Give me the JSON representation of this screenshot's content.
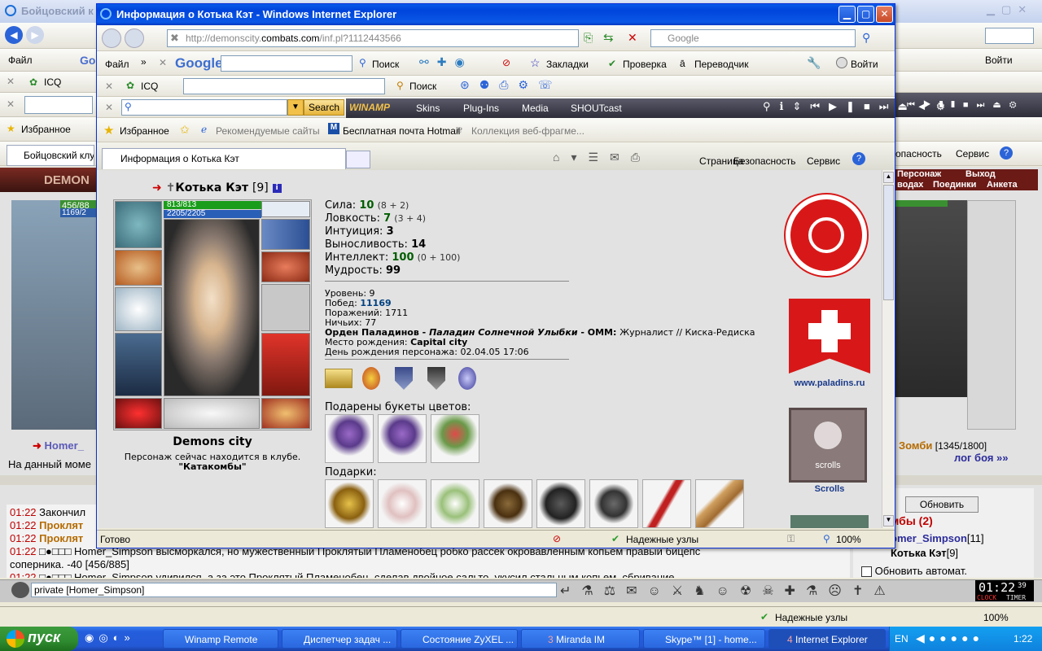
{
  "background_window": {
    "title": "Бойцовский к",
    "menu_file": "Файл",
    "google_fragment": "Go",
    "icq": "ICQ",
    "favorites": "Избранное",
    "tab_title": "Бойцовский клуб",
    "security_fragment": "опасность",
    "service": "Сервис",
    "tab_personazh": "Персонаж",
    "tab_vyhod": "Выход",
    "tab_vodah": "водах",
    "tab_poedinki": "Поединки",
    "tab_anketa": "Анкета",
    "left_hp": "456/88",
    "left_mp": "1169/2",
    "left_player_link": "Homer_",
    "left_note": "На данный моме",
    "right_player": "Зомби",
    "right_hp": "[1345/1800]",
    "log_link": "лог боя »»",
    "refresh_button": "Обновить",
    "zombies_count": "мбы (2)",
    "list_user1": "omer_Simpson",
    "list_user1_level": "[11]",
    "list_user2": "Котька Кэт",
    "list_user2_level": "[9]",
    "auto_refresh": "Обновить автомат.",
    "chat_lines": [
      {
        "time": "01:22",
        "text": "Закончил"
      },
      {
        "time": "01:22",
        "text": "Проклят"
      },
      {
        "time": "01:22",
        "text": "Проклят"
      },
      {
        "time": "01:22",
        "text": "□●□□□ Homer_Simpson высморкался, но мужественный Проклятый Пламенобец робко рассек окровавленным копьем правый бицепс"
      },
      {
        "time": "",
        "text": "соперника. -40 [456/885]"
      },
      {
        "time": "01:22",
        "text": "□●□□□ Homer_Simpson удивился, а за это Проклятый Пламенобец, сделав двойное сальто, укусил стальным копьем, сбривание"
      }
    ],
    "chat_input": "private [Homer_Simpson]",
    "clock": "01:22",
    "clock_seconds": "39",
    "clock_label": "CLOCK",
    "timer_label": "TIMER",
    "status_zone": "Надежные узлы",
    "status_zoom": "100%"
  },
  "taskbar": {
    "start": "пуск",
    "tasks": [
      "Winamp Remote",
      "Диспетчер задач ...",
      "Состояние ZyXEL ...",
      "Miranda IM",
      "Skype™ [1] - home...",
      "Internet Explorer"
    ],
    "miranda_count": "3",
    "ie_count": "4",
    "lang": "EN",
    "time": "1:22"
  },
  "ie": {
    "title": "Информация о Котька Кэт - Windows Internet Explorer",
    "address_prefix": "http://demonscity.",
    "address_domain": "combats.com",
    "address_suffix": "/inf.pl?1112443566",
    "search_placeholder": "Google",
    "menu_file": "Файл",
    "google_label": "Google",
    "poisk": "Поиск",
    "zakladki": "Закладки",
    "proverka": "Проверка",
    "perevodchik": "Переводчик",
    "voiti": "Войти",
    "icq": "ICQ",
    "icq_poisk": "Поиск",
    "search_button": "Search",
    "winamp_logo": "WINAMP",
    "skins": "Skins",
    "plugins": "Plug-Ins",
    "media": "Media",
    "shoutcast": "SHOUTcast",
    "favorites": "Избранное",
    "fav1": "Рекомендуемые сайты",
    "fav2": "Бесплатная почта Hotmail",
    "fav3": "Коллекция веб-фрагме...",
    "tab_title": "Информация о Котька Кэт",
    "cmd_page": "Страница",
    "cmd_security": "Безопасность",
    "cmd_service": "Сервис",
    "status_ready": "Готово",
    "status_zone": "Надежные узлы",
    "status_zoom": "100%"
  },
  "character": {
    "name": "Котька Кэт",
    "level_tag": "[9]",
    "hp": "813/813",
    "mp": "2205/2205",
    "hp_fraction": 1.0,
    "mp_fraction": 1.0,
    "city": "Demons city",
    "location_text": "Персонаж сейчас находится в клубе.",
    "location_room": "\"Катакомбы\"",
    "stats": [
      {
        "label": "Сила:",
        "value": "10",
        "mod": "(8 + 2)"
      },
      {
        "label": "Ловкость:",
        "value": "7",
        "mod": "(3 + 4)"
      },
      {
        "label": "Интуиция:",
        "value": "3",
        "mod": ""
      },
      {
        "label": "Выносливость:",
        "value": "14",
        "mod": ""
      },
      {
        "label": "Интеллект:",
        "value": "100",
        "mod": "(0 + 100)"
      },
      {
        "label": "Мудрость:",
        "value": "99",
        "mod": ""
      }
    ],
    "level_label": "Уровень:",
    "level": "9",
    "wins_label": "Побед:",
    "wins": "11169",
    "losses_label": "Поражений:",
    "losses": "1711",
    "draws_label": "Ничьих:",
    "draws": "77",
    "order": "Орден Паладинов",
    "order_sep": " - ",
    "order_rank": "Паладин Солнечной Улыбки",
    "omm_label": " - ОММ: ",
    "omm_value": "Журналист // Киска-Редиска",
    "birthplace_label": "Место рождения:",
    "birthplace": "Capital city",
    "birthday_label": "День рождения персонажа:",
    "birthday": "02.04.05 17:06",
    "flowers_label": "Подарены букеты цветов:",
    "gifts_label": "Подарки:",
    "paladins_url": "www.paladins.ru",
    "scrolls_banner": "scrolls",
    "scrolls_label": "Scrolls"
  }
}
